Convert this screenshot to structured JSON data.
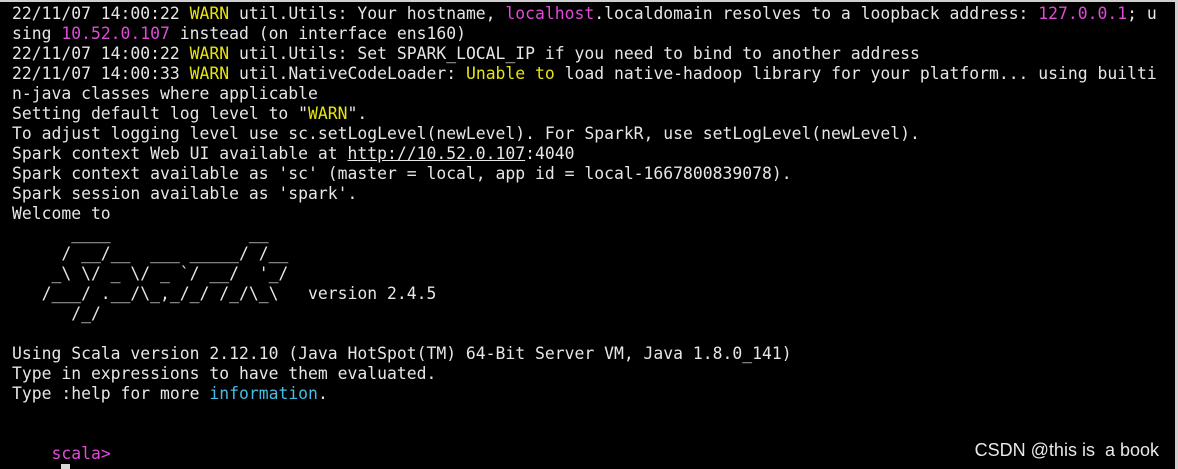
{
  "terminal": {
    "lines": [
      {
        "segments": [
          {
            "text": "22/11/07 14:00:22 "
          },
          {
            "text": "WARN",
            "style": "warn"
          },
          {
            "text": " util.Utils: Your hostname, "
          },
          {
            "text": "localhost",
            "style": "mag"
          },
          {
            "text": ".localdomain resolves to a loopback address: "
          },
          {
            "text": "127.0.0.1",
            "style": "mag"
          },
          {
            "text": "; u"
          }
        ]
      },
      {
        "segments": [
          {
            "text": "sing "
          },
          {
            "text": "10.52.0.107",
            "style": "mag"
          },
          {
            "text": " instead (on interface ens160)"
          }
        ]
      },
      {
        "segments": [
          {
            "text": "22/11/07 14:00:22 "
          },
          {
            "text": "WARN",
            "style": "warn"
          },
          {
            "text": " util.Utils: Set SPARK_LOCAL_IP if you need to bind to another address"
          }
        ]
      },
      {
        "segments": [
          {
            "text": "22/11/07 14:00:33 "
          },
          {
            "text": "WARN",
            "style": "warn"
          },
          {
            "text": " util.NativeCodeLoader: "
          },
          {
            "text": "Unable to",
            "style": "warn"
          },
          {
            "text": " load native-hadoop library for your platform... using builti"
          }
        ]
      },
      {
        "segments": [
          {
            "text": "n-java classes where applicable"
          }
        ]
      },
      {
        "segments": [
          {
            "text": "Setting default log level to \""
          },
          {
            "text": "WARN",
            "style": "warn"
          },
          {
            "text": "\"."
          }
        ]
      },
      {
        "segments": [
          {
            "text": "To adjust logging level use sc.setLogLevel(newLevel). For SparkR, use setLogLevel(newLevel)."
          }
        ]
      },
      {
        "segments": [
          {
            "text": "Spark context Web UI available at "
          },
          {
            "text": "http://10.52.0.107",
            "style": "link"
          },
          {
            "text": ":4040"
          }
        ]
      },
      {
        "segments": [
          {
            "text": "Spark context available as 'sc' (master = local, app id = local-1667800839078)."
          }
        ]
      },
      {
        "segments": [
          {
            "text": "Spark session available as 'spark'."
          }
        ]
      },
      {
        "segments": [
          {
            "text": "Welcome to"
          }
        ]
      },
      {
        "segments": [
          {
            "text": "      ____              __"
          }
        ]
      },
      {
        "segments": [
          {
            "text": "     / __/__  ___ _____/ /__"
          }
        ]
      },
      {
        "segments": [
          {
            "text": "    _\\ \\/ _ \\/ _ `/ __/  '_/"
          }
        ]
      },
      {
        "segments": [
          {
            "text": "   /___/ .__/\\_,_/_/ /_/\\_\\   version 2.4.5"
          }
        ]
      },
      {
        "segments": [
          {
            "text": "      /_/"
          }
        ]
      },
      {
        "segments": [
          {
            "text": ""
          }
        ]
      },
      {
        "segments": [
          {
            "text": "Using Scala version 2.12.10 (Java HotSpot(TM) 64-Bit Server VM, Java 1.8.0_141)"
          }
        ]
      },
      {
        "segments": [
          {
            "text": "Type in expressions to have them evaluated."
          }
        ]
      },
      {
        "segments": [
          {
            "text": "Type :help for more "
          },
          {
            "text": "information",
            "style": "cyan"
          },
          {
            "text": "."
          }
        ]
      },
      {
        "segments": [
          {
            "text": ""
          }
        ]
      }
    ],
    "prompt": "scala>",
    "colors": {
      "background": "#000000",
      "foreground": "#e6e6e6",
      "warn": "#e5e510",
      "magenta": "#e24ad9",
      "cyan": "#45bde4"
    }
  },
  "watermark": "CSDN @this is  a book"
}
